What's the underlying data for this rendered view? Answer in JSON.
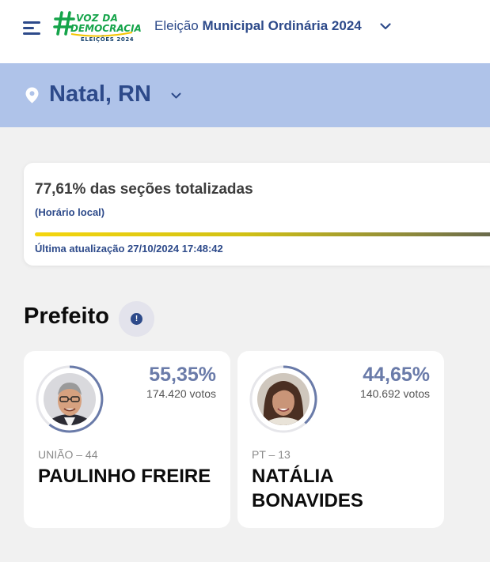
{
  "header": {
    "menu_icon": "hamburger-menu-icon",
    "logo": {
      "line1": "VOZ DA",
      "line2": "DEMOCRACIA",
      "line3": "ELEIÇÕES 2024"
    },
    "election_prefix": "Eleição",
    "election_name": "Municipal Ordinária 2024"
  },
  "location": {
    "city": "Natal, RN",
    "icon": "map-pin-icon"
  },
  "progress": {
    "sections_text": "77,61% das seções totalizadas",
    "sections_percent": 77.61,
    "local_time_note": "(Horário local)",
    "last_update": "Última atualização 27/10/2024 17:48:42"
  },
  "office": {
    "title": "Prefeito",
    "info_icon": "info-icon",
    "info_glyph": "!"
  },
  "candidates": [
    {
      "percent": "55,35%",
      "percent_value": 55.35,
      "votes": "174.420 votos",
      "party": "UNIÃO – 44",
      "name": "PAULINHO FREIRE"
    },
    {
      "percent": "44,65%",
      "percent_value": 44.65,
      "votes": "140.692 votos",
      "party": "PT – 13",
      "name": "NATÁLIA BONAVIDES"
    }
  ],
  "colors": {
    "primary": "#2d4a8a",
    "city_bar": "#afc3e9",
    "percent": "#6a7ba9",
    "logo_green": "#15a44a"
  }
}
